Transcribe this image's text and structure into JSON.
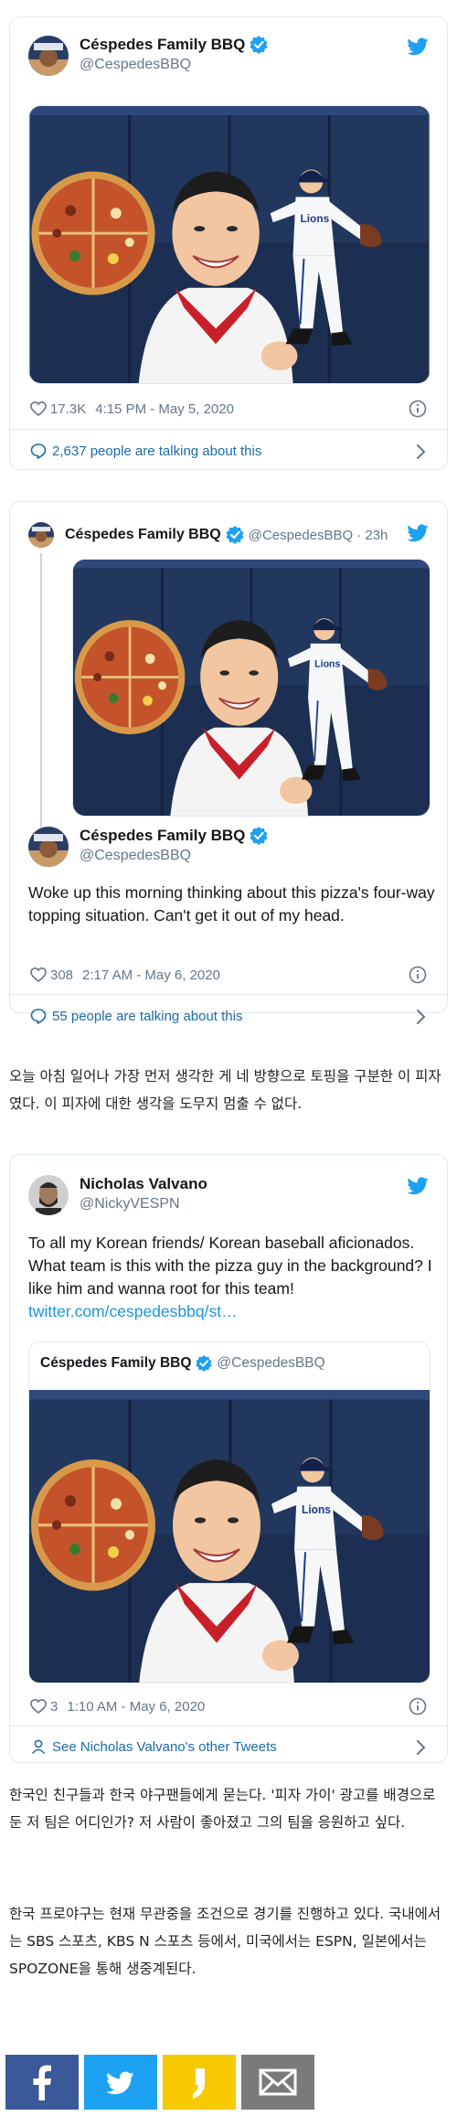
{
  "tweet1": {
    "name": "Céspedes Family BBQ",
    "handle": "@CespedesBBQ",
    "likes": "17.3K",
    "time": "4:15 PM - May 5, 2020",
    "talking": "2,637 people are talking about this"
  },
  "tweet2": {
    "name": "Céspedes Family BBQ",
    "handle": "@CespedesBBQ",
    "age": "· 23h",
    "reply_name": "Céspedes Family BBQ",
    "reply_handle": "@CespedesBBQ",
    "text": "Woke up this morning thinking about this pizza's four-way topping situation. Can't get it out of my head.",
    "likes": "308",
    "time": "2:17 AM - May 6, 2020",
    "talking": "55 people are talking about this"
  },
  "korean1": "오늘 아침 일어나 가장 먼저 생각한 게 네 방향으로 토핑을 구분한 이 피자였다. 이 피자에 대한 생각을 도무지 멈출 수 없다.",
  "tweet3": {
    "name": "Nicholas Valvano",
    "handle": "@NickyVESPN",
    "text": "To all my Korean friends/ Korean baseball aficionados.  What team is this with the pizza guy in the background?  I like him and wanna root for this team! ",
    "link": "twitter.com/cespedesbbq/st…",
    "quote_name": "Céspedes Family BBQ",
    "quote_handle": "@CespedesBBQ",
    "likes": "3",
    "time": "1:10 AM - May 6, 2020",
    "see_more": "See Nicholas Valvano's other Tweets"
  },
  "korean2": "한국인 친구들과 한국 야구팬들에게 묻는다. '피자 가이' 광고를 배경으로 둔 저 팀은 어디인가? 저 사람이 좋아졌고 그의 팀을 응원하고 싶다.",
  "korean3": "한국 프로야구는 현재 무관중을 조건으로 경기를 진행하고 있다. 국내에서는 SBS 스포츠, KBS N 스포츠 등에서, 미국에서는 ESPN, 일본에서는 SPOZONE을 통해 생중계된다.",
  "share": {
    "facebook_color": "#3b5998",
    "twitter_color": "#1da1f2",
    "kakao_color": "#f7c900",
    "email_color": "#7a7a7a"
  }
}
